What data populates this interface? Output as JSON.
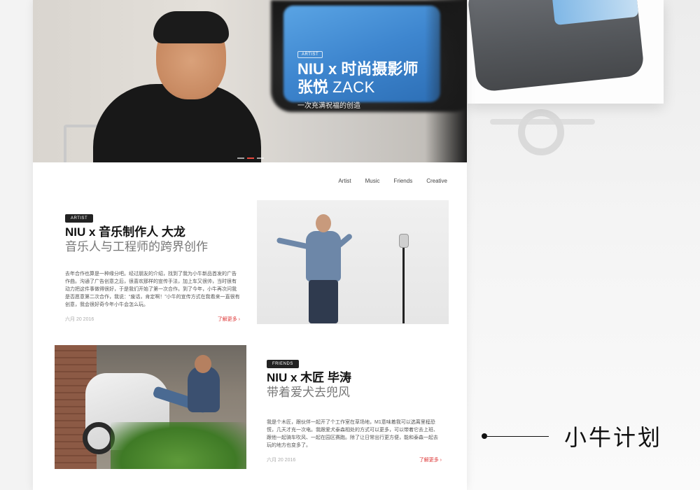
{
  "hero": {
    "badge": "ARTIST",
    "title_line1": "NIU x 时尚摄影师",
    "title_line2_cn": "张悦",
    "title_line2_en": "ZACK",
    "subtitle": "一次充满祝福的创造"
  },
  "nav": [
    "Artist",
    "Music",
    "Friends",
    "Creative"
  ],
  "articles": [
    {
      "badge": "ARTIST",
      "title": "NIU x 音乐制作人 大龙",
      "subtitle": "音乐人与工程师的跨界创作",
      "body": "去年合作也算是一种缘分吧。经过朋友的介绍，找到了我为小牛新品首发的广告作曲。沟通了广告创意之后，很喜欢那样的宣传手法，加上车又很帅，当时很有动力把这件事做得很好，于是我们开始了第一次合作。到了今年，小牛再次问我是否愿意第二次合作，我说：“废话，肯定啊！”小牛的宣传方式在我看来一直很有创意，我会很好奇今年小牛会怎么玩。",
      "date": "六月 20 2016",
      "more": "了解更多"
    },
    {
      "badge": "FRIENDS",
      "title": "NIU x 木匠 毕涛",
      "subtitle": "带着爱犬去兜风",
      "body": "我是个木匠，跟伙伴一起开了个工作室在草场地，M1意味着我可以选离里程恐慌，几天才充一次电。我跟爱犬泰森相处的方式可以更多，可以带着它去上班、跟他一起骑车吹风、一起在园区赛跑。除了让日常出行更方便，能和泰森一起去玩的地方也变多了。",
      "date": "六月 20 2016",
      "more": "了解更多"
    }
  ],
  "caption": "小牛计划",
  "colors": {
    "accent": "#e94a3f",
    "badge_bg": "#222222"
  }
}
